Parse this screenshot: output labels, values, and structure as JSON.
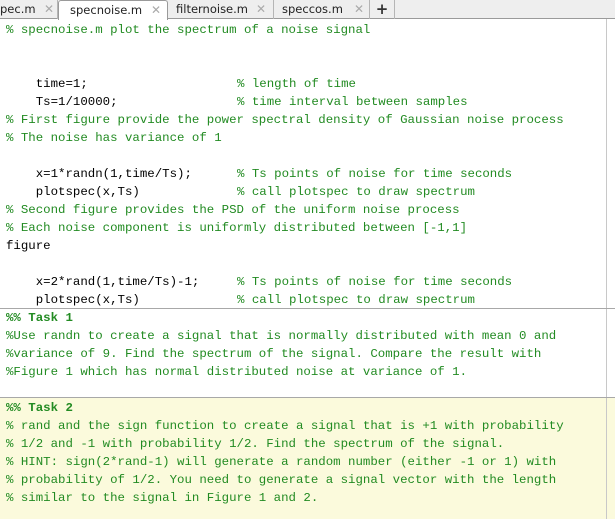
{
  "tabs": [
    {
      "label": "pec.m",
      "active": false
    },
    {
      "label": "specnoise.m",
      "active": true
    },
    {
      "label": "filternoise.m",
      "active": false
    },
    {
      "label": "speccos.m",
      "active": false
    }
  ],
  "tab_close_glyph": "✕",
  "new_tab_label": "+",
  "colors": {
    "comment": "#228b22",
    "code": "#000000",
    "active_cell_bg": "#fbfadc"
  },
  "code": {
    "header": "% specnoise.m plot the spectrum of a noise signal",
    "l_time": {
      "code": "time=1;",
      "comment": "% length of time"
    },
    "l_ts": {
      "code": "Ts=1/10000;",
      "comment": "% time interval between samples"
    },
    "c_first1": "% First figure provide the power spectral density of Gaussian noise process",
    "c_first2": "% The noise has variance of 1",
    "l_x1": {
      "code": "x=1*randn(1,time/Ts);",
      "comment": "% Ts points of noise for time seconds"
    },
    "l_plot1": {
      "code": "plotspec(x,Ts)",
      "comment": "% call plotspec to draw spectrum"
    },
    "c_second1": "% Second figure provides the PSD of the uniform noise process",
    "c_second2": "% Each noise component is uniformly distributed between [-1,1]",
    "l_figure": "figure",
    "l_x2": {
      "code": "x=2*rand(1,time/Ts)-1;",
      "comment": "% Ts points of noise for time seconds"
    },
    "l_plot2": {
      "code": "plotspec(x,Ts)",
      "comment": "% call plotspec to draw spectrum"
    }
  },
  "task1": {
    "title": "%% Task 1",
    "lines": [
      "%Use randn to create a signal that is normally distributed with mean 0 and",
      "%variance of 9. Find the spectrum of the signal. Compare the result with",
      "%Figure 1 which has normal distributed noise at variance of 1."
    ]
  },
  "task2": {
    "title": "%% Task 2",
    "lines": [
      "% rand and the sign function to create a signal that is +1 with probability",
      "% 1/2 and -1 with probability 1/2. Find the spectrum of the signal.",
      "% HINT: sign(2*rand-1) will generate a random number (either -1 or 1) with",
      "% probability of 1/2. You need to generate a signal vector with the length",
      "% similar to the signal in Figure 1 and 2."
    ]
  }
}
